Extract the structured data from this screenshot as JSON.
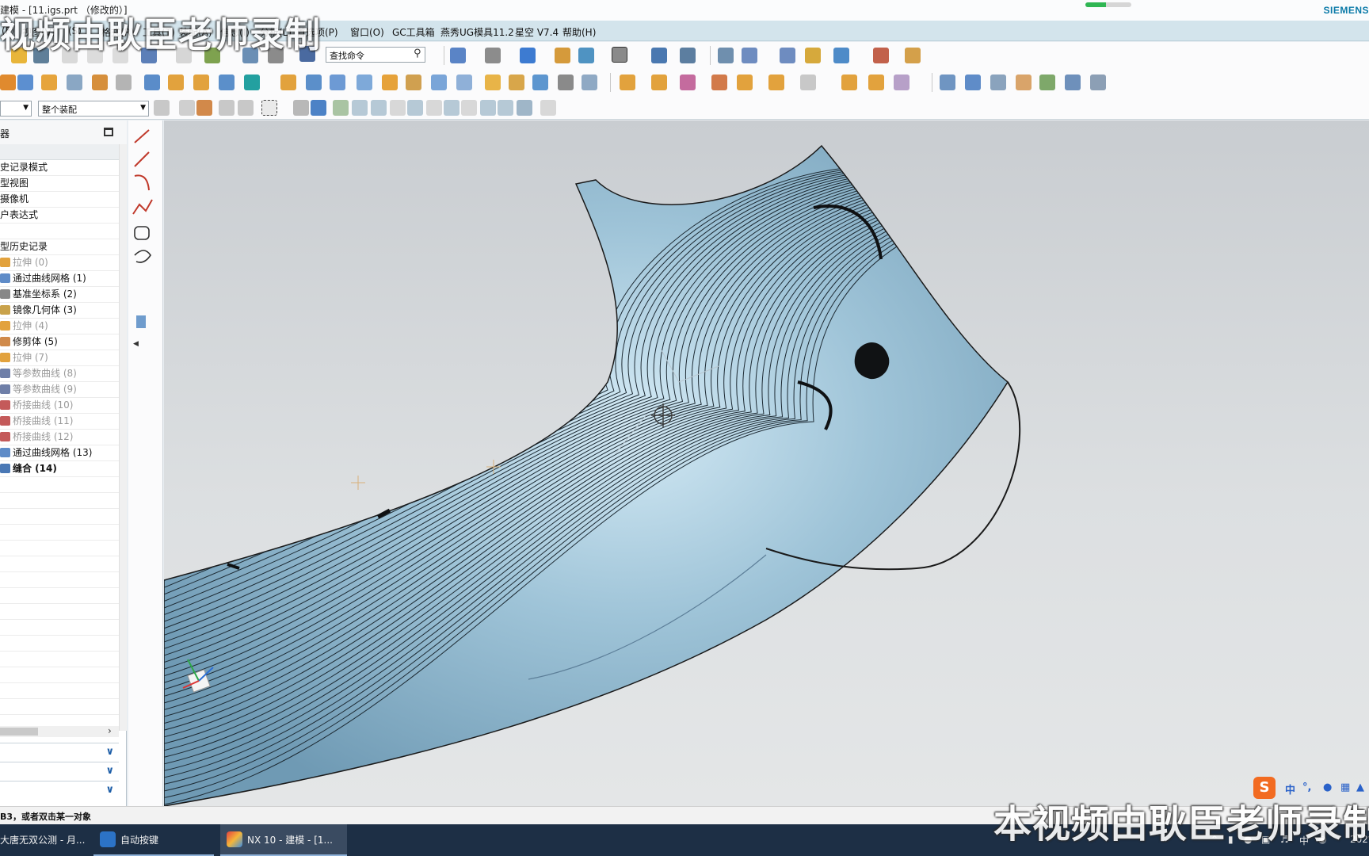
{
  "window": {
    "title": "建模 - [11.igs.prt （修改的）]",
    "brand": "SIEMENS",
    "progress_fraction": 0.45
  },
  "watermark": {
    "top": "视频由耿臣老师录制",
    "bottom": "本视频由耿臣老师录制"
  },
  "menu": {
    "items": [
      "(F)",
      "视图(V)",
      "(S)",
      "格式(R)",
      "工具(T)",
      "装配(A)",
      "信息(I)",
      "分析(L)",
      "首选项(P)",
      "窗口(O)",
      "GC工具箱",
      "燕秀UG模具11.2",
      "星空 V7.4",
      "帮助(H)"
    ]
  },
  "toolbar": {
    "search_placeholder": "查找命令",
    "assembly_scope": "整个装配"
  },
  "navigator": {
    "header": "器",
    "items": [
      {
        "label": "史记录模式",
        "state": "normal",
        "icon": "none"
      },
      {
        "label": "型视图",
        "state": "normal",
        "icon": "none"
      },
      {
        "label": "摄像机",
        "state": "normal",
        "icon": "none"
      },
      {
        "label": "户表达式",
        "state": "normal",
        "icon": "none"
      },
      {
        "label": "",
        "state": "normal",
        "icon": "none"
      },
      {
        "label": "型历史记录",
        "state": "normal",
        "icon": "none"
      },
      {
        "label": "拉伸 (0)",
        "state": "dim",
        "icon": "extrude"
      },
      {
        "label": "通过曲线网格 (1)",
        "state": "normal",
        "icon": "mesh"
      },
      {
        "label": "基准坐标系 (2)",
        "state": "normal",
        "icon": "csys"
      },
      {
        "label": "镜像几何体 (3)",
        "state": "normal",
        "icon": "mirror"
      },
      {
        "label": "拉伸 (4)",
        "state": "dim",
        "icon": "extrude"
      },
      {
        "label": "修剪体 (5)",
        "state": "normal",
        "icon": "trim"
      },
      {
        "label": "拉伸 (7)",
        "state": "dim",
        "icon": "extrude"
      },
      {
        "label": "等参数曲线 (8)",
        "state": "dim",
        "icon": "iso"
      },
      {
        "label": "等参数曲线 (9)",
        "state": "dim",
        "icon": "iso"
      },
      {
        "label": "桥接曲线 (10)",
        "state": "dim",
        "icon": "bridge"
      },
      {
        "label": "桥接曲线 (11)",
        "state": "dim",
        "icon": "bridge"
      },
      {
        "label": "桥接曲线 (12)",
        "state": "dim",
        "icon": "bridge"
      },
      {
        "label": "通过曲线网格 (13)",
        "state": "normal",
        "icon": "mesh"
      },
      {
        "label": "缝合 (14)",
        "state": "bold",
        "icon": "sew"
      }
    ]
  },
  "status": {
    "message": "B3，或者双击某一对象"
  },
  "taskbar": {
    "tasks": [
      {
        "label": "大唐无双公测 - 月...",
        "active": false
      },
      {
        "label": "自动按键",
        "active": false
      },
      {
        "label": "NX 10 - 建模 - [1...",
        "active": true
      }
    ],
    "tray_ime": "中",
    "clock_partial": "202"
  },
  "ime_bar": {
    "lang": "中",
    "punct": "°,"
  },
  "colors": {
    "surface": "#8fb6cc",
    "surface_highlight": "#cfe6f2",
    "menubar": "#d3e4ec",
    "taskbar": "#1d2f45",
    "brand": "#0a7aa8"
  }
}
